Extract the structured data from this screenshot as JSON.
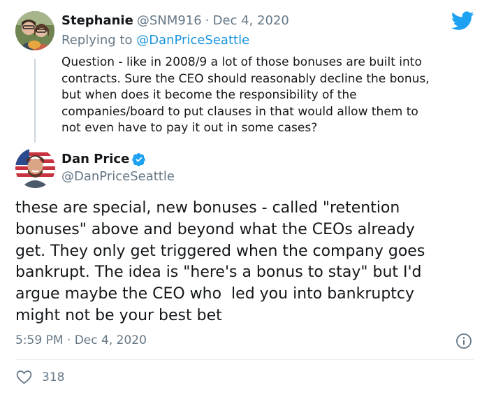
{
  "reply_tweet": {
    "name": "Stephanie",
    "handle": "@SNM916",
    "separator": "·",
    "date": "Dec 4, 2020",
    "replying_prefix": "Replying to",
    "replying_to": "@DanPriceSeattle",
    "lines": [
      "Question - like in 2008/9 a lot of those bonuses are built into",
      "contracts. Sure the CEO should reasonably decline the bonus,",
      "but when does it become the responsibility of the",
      "companies/board to put clauses in that would allow them to",
      "not even have to pay it out in some cases?"
    ]
  },
  "main_tweet": {
    "name": "Dan Price",
    "handle": "@DanPriceSeattle",
    "lines": [
      "these are special, new bonuses - called \"retention",
      "bonuses\" above and beyond what the CEOs already",
      "get. They only get triggered when the company goes",
      "bankrupt. The idea is \"here's a bonus to stay\" but I'd",
      "argue maybe the CEO who  led you into bankruptcy",
      "might not be your best bet"
    ],
    "time": "5:59 PM",
    "separator": "·",
    "date": "Dec 4, 2020",
    "likes": "318"
  },
  "colors": {
    "twitter_blue": "#1da1f2",
    "link_blue": "#1b95e0",
    "muted": "#657786",
    "text": "#14171a",
    "divider": "#e6ecf0"
  },
  "icons": {
    "logo": "twitter-bird-icon",
    "verified": "verified-badge-icon",
    "info": "info-icon",
    "like": "heart-icon"
  }
}
